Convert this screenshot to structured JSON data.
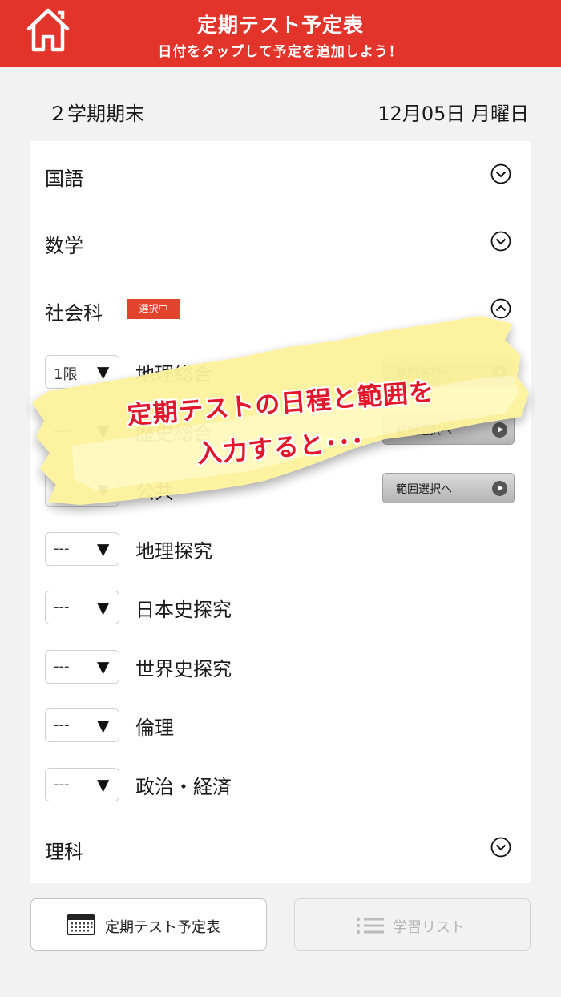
{
  "header": {
    "title": "定期テスト予定表",
    "subtitle": "日付をタップして予定を追加しよう！",
    "home_icon": "home-icon",
    "color": "#e2342a"
  },
  "term": {
    "name": "２学期期末",
    "date": "12月05日 月曜日"
  },
  "subjects": [
    {
      "label": "国語",
      "icon": "chevron-down-icon"
    },
    {
      "label": "数学",
      "icon": "chevron-down-icon"
    },
    {
      "label": "社会科",
      "badge": "選択中",
      "icon": "chevron-up-icon"
    },
    {
      "label": "理科",
      "icon": "chevron-down-icon"
    }
  ],
  "social_courses": [
    {
      "period": "1限",
      "name": "地理総合",
      "range_button": "範囲選択へ"
    },
    {
      "period": "---",
      "name": "歴史総合",
      "range_button": "範囲選択へ"
    },
    {
      "period": "---",
      "name": "公共",
      "range_button": "範囲選択へ"
    },
    {
      "period": "---",
      "name": "地理探究"
    },
    {
      "period": "---",
      "name": "日本史探究"
    },
    {
      "period": "---",
      "name": "世界史探究"
    },
    {
      "period": "---",
      "name": "倫理"
    },
    {
      "period": "---",
      "name": "政治・経済"
    }
  ],
  "dropdown_arrow": "▼",
  "footer": {
    "schedule_label": "定期テスト予定表",
    "schedule_icon": "calendar-icon",
    "study_list_label": "学習リスト",
    "study_list_icon": "list-icon"
  },
  "banner": {
    "line1": "定期テストの日程と範囲を",
    "line2": "入力すると･･･",
    "text_color": "#e2172a",
    "fill_color": "#fdf29a"
  }
}
